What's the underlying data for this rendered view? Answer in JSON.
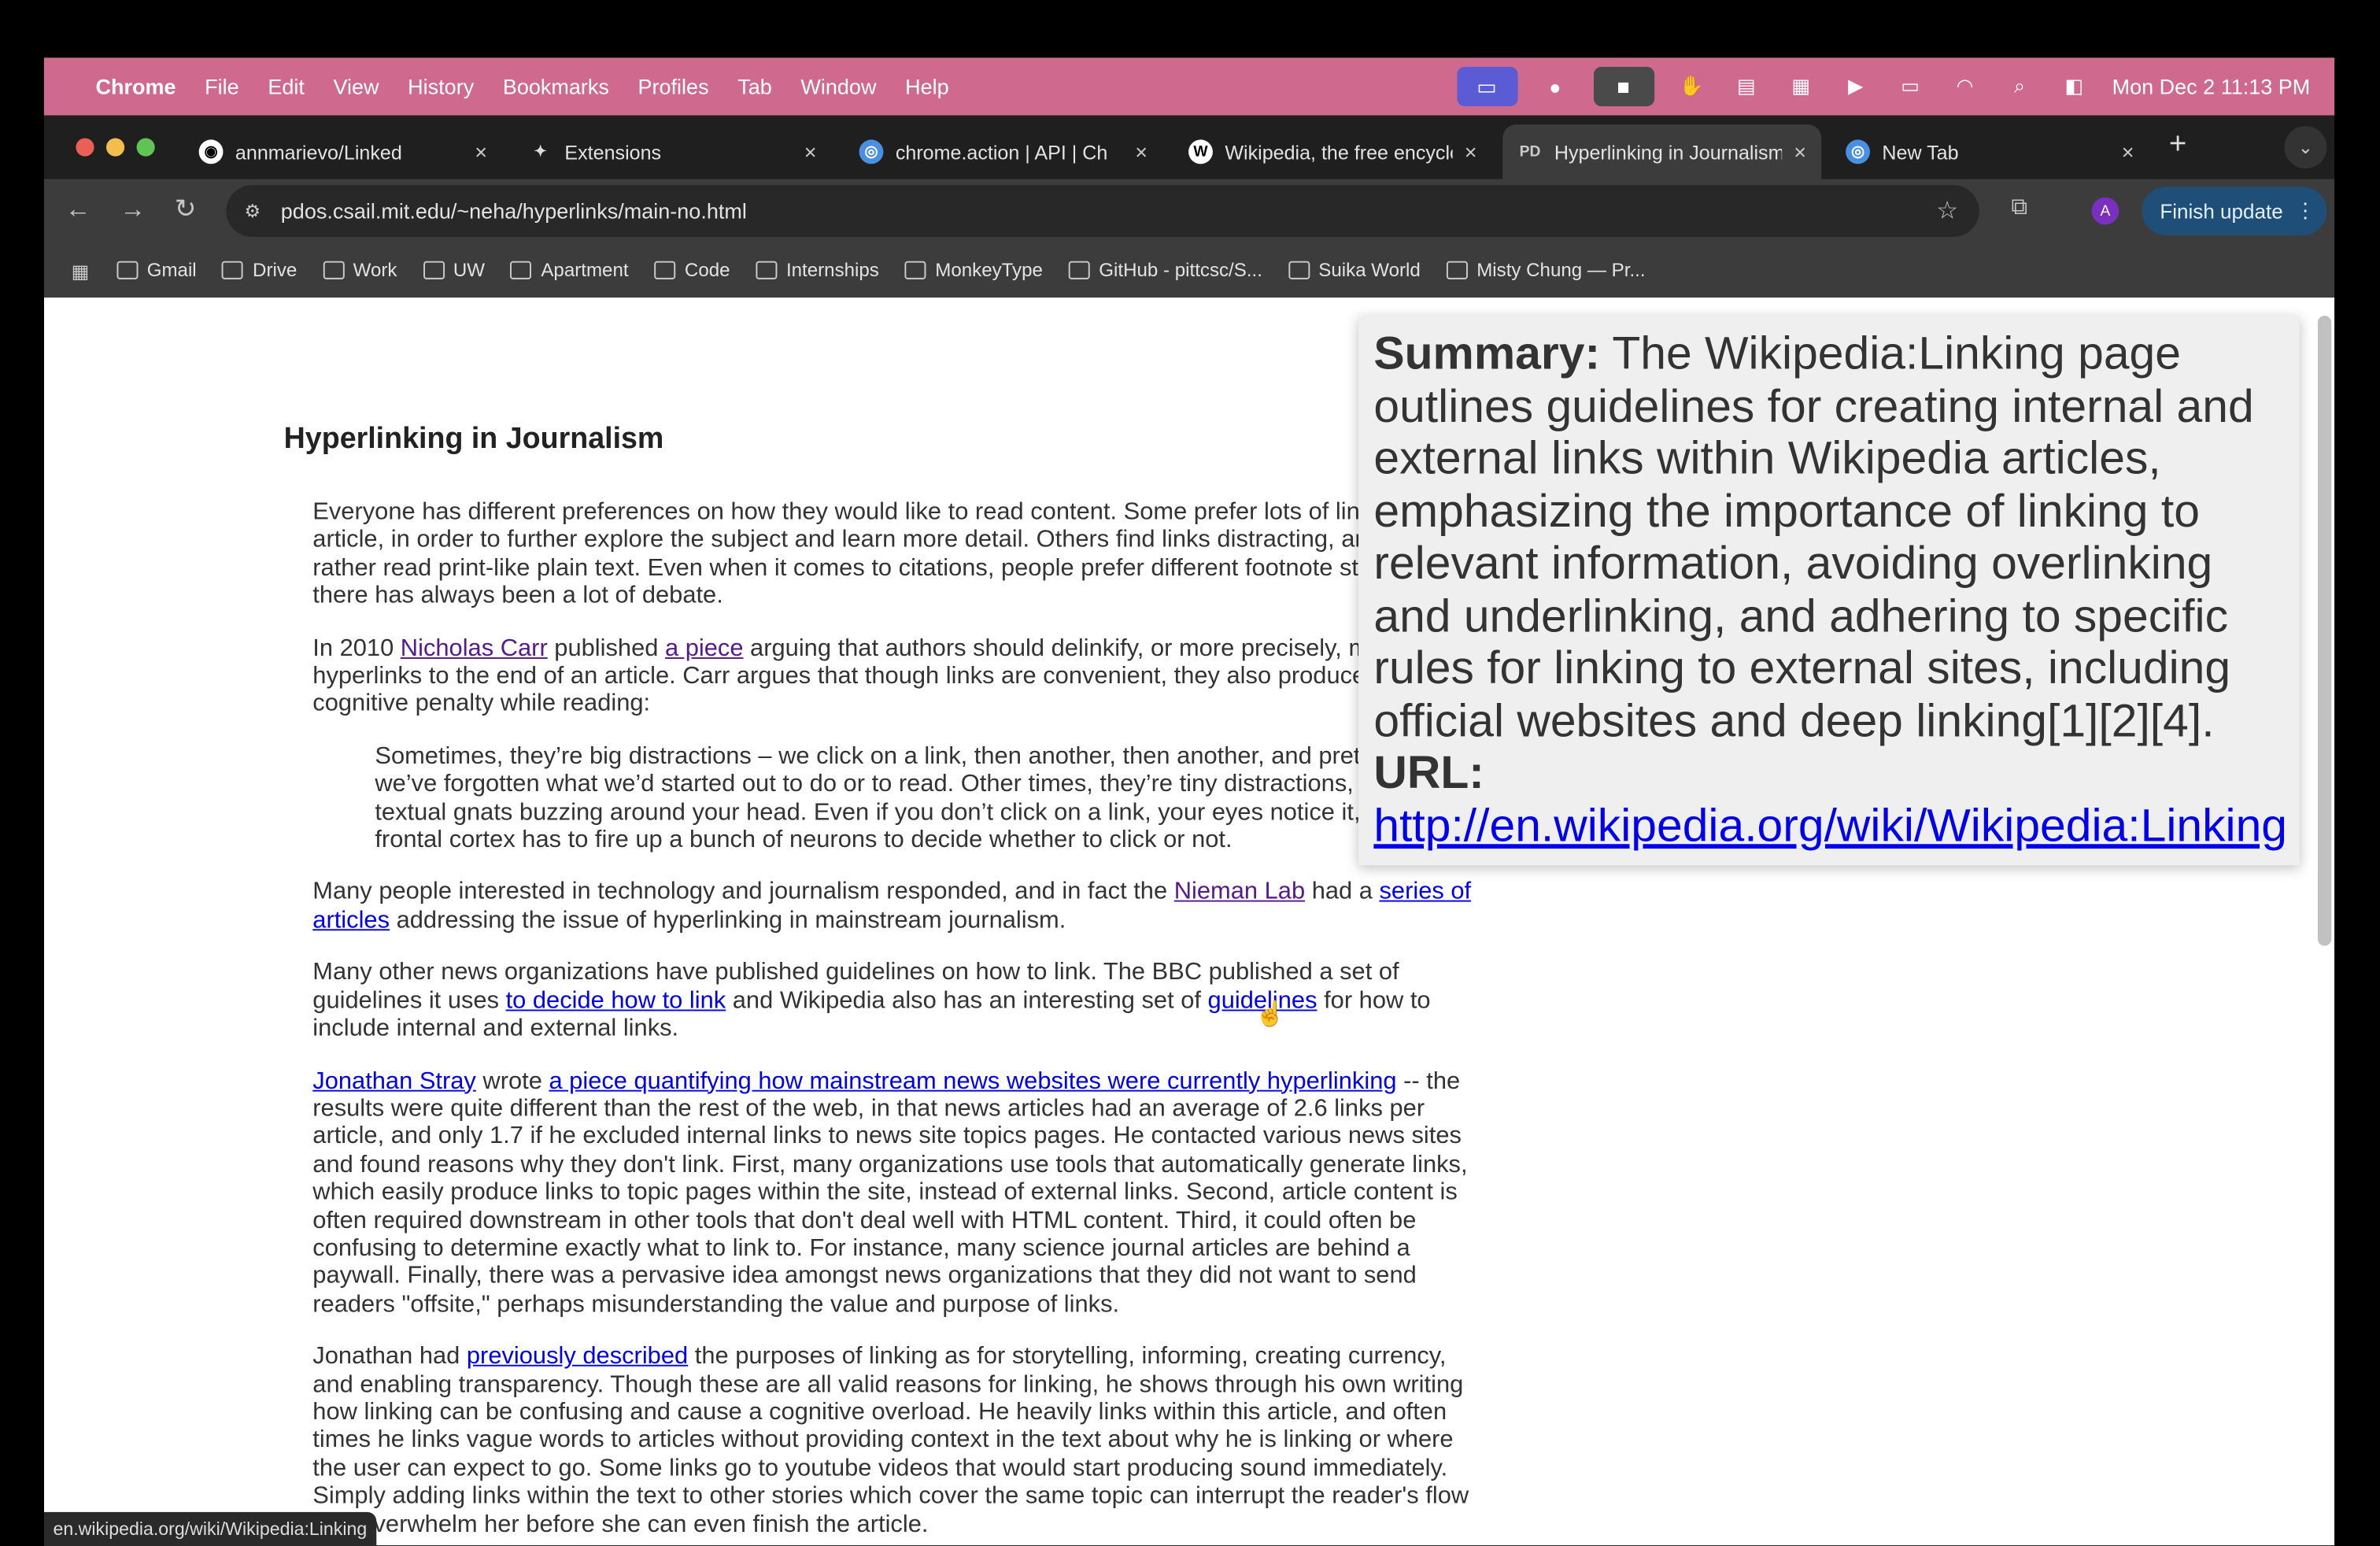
{
  "menubar": {
    "app": "Chrome",
    "items": [
      "File",
      "Edit",
      "View",
      "History",
      "Bookmarks",
      "Profiles",
      "Tab",
      "Window",
      "Help"
    ],
    "clock": "Mon Dec 2  11:13 PM"
  },
  "tabs": [
    {
      "label": "annmarievo/Linked",
      "icon": "github-icon"
    },
    {
      "label": "Extensions",
      "icon": "puzzle-icon"
    },
    {
      "label": "chrome.action | API | Ch",
      "icon": "chrome-icon"
    },
    {
      "label": "Wikipedia, the free encyclopedia",
      "icon": "wikipedia-icon"
    },
    {
      "label": "Hyperlinking in Journalism",
      "icon": "pdos-icon",
      "active": true
    },
    {
      "label": "New Tab",
      "icon": "chrome-icon"
    }
  ],
  "toolbar": {
    "url": "pdos.csail.mit.edu/~neha/hyperlinks/main-no.html",
    "finish_update": "Finish update",
    "avatar": "A"
  },
  "bookmarks": [
    "Gmail",
    "Drive",
    "Work",
    "UW",
    "Apartment",
    "Code",
    "Internships",
    "MonkeyType",
    "GitHub - pittcsc/S...",
    "Suika World",
    "Misty Chung — Pr..."
  ],
  "article": {
    "title": "Hyperlinking in Journalism",
    "blocks": [
      {
        "type": "p",
        "segs": [
          {
            "t": "Everyone has different preferences on how they would like to read content. Some prefer lots of links in an article, in order to further explore the subject and learn more detail. Others find links distracting, and would rather read print-like plain text. Even when it comes to citations, people prefer different footnote styles and there has always been a lot of debate."
          }
        ]
      },
      {
        "type": "p",
        "segs": [
          {
            "t": "In 2010 "
          },
          {
            "t": "Nicholas Carr",
            "link": "visited"
          },
          {
            "t": " published "
          },
          {
            "t": "a piece",
            "link": "visited"
          },
          {
            "t": " arguing that authors should delinkify, or more precisely, move hyperlinks to the end of an article. Carr argues that though links are convenient, they also produce a cognitive penalty while reading:"
          }
        ]
      },
      {
        "type": "q",
        "segs": [
          {
            "t": "Sometimes, they’re big distractions – we click on a link, then another, then another, and pretty soon we’ve forgotten what we’d started out to do or to read. Other times, they’re tiny distractions, little textual gnats buzzing around your head. Even if you don’t click on a link, your eyes notice it, and your frontal cortex has to fire up a bunch of neurons to decide whether to click or not."
          }
        ]
      },
      {
        "type": "p",
        "segs": [
          {
            "t": "Many people interested in technology and journalism responded, and in fact the "
          },
          {
            "t": "Nieman Lab",
            "link": "visited"
          },
          {
            "t": " had a "
          },
          {
            "t": "series of articles",
            "link": "new"
          },
          {
            "t": " addressing the issue of hyperlinking in mainstream journalism."
          }
        ]
      },
      {
        "type": "p",
        "segs": [
          {
            "t": "Many other news organizations have published guidelines on how to link. The BBC published a set of guidelines it uses "
          },
          {
            "t": "to decide how to link",
            "link": "new"
          },
          {
            "t": " and Wikipedia also has an interesting set of "
          },
          {
            "t": "guidelines",
            "link": "new"
          },
          {
            "t": " for how to include internal and external links."
          }
        ]
      },
      {
        "type": "p",
        "segs": [
          {
            "t": "Jonathan Stray",
            "link": "new"
          },
          {
            "t": " wrote "
          },
          {
            "t": "a piece quantifying how mainstream news websites were currently hyperlinking",
            "link": "new"
          },
          {
            "t": " -- the results were quite different than the rest of the web, in that news articles had an average of 2.6 links per article, and only 1.7 if he excluded internal links to news site topics pages. He contacted various news sites and found reasons why they don't link. First, many organizations use tools that automatically generate links, which easily produce links to topic pages within the site, instead of external links. Second, article content is often required downstream in other tools that don't deal well with HTML content. Third, it could often be confusing to determine exactly what to link to. For instance, many science journal articles are behind a paywall. Finally, there was a pervasive idea amongst news organizations that they did not want to send readers \"offsite,\" perhaps misunderstanding the value and purpose of links."
          }
        ]
      },
      {
        "type": "p",
        "segs": [
          {
            "t": "Jonathan had "
          },
          {
            "t": "previously described",
            "link": "new"
          },
          {
            "t": " the purposes of linking as for storytelling, informing, creating currency, and enabling transparency. Though these are all valid reasons for linking, he shows through his own writing how linking can be confusing and cause a cognitive overload. He heavily links within this article, and often times he links vague words to articles without providing context in the text about why he is linking or where the user can expect to go. Some links go to youtube videos that would start producing sound immediately. Simply adding links within the text to other stories which cover the same topic can interrupt the reader's flow and overwhelm her before she can even finish the article."
          }
        ]
      }
    ]
  },
  "popup": {
    "summary_label": "Summary:",
    "summary": " The Wikipedia:Linking page outlines guidelines for creating internal and external links within Wikipedia articles, emphasizing the importance of linking to relevant information, avoiding overlinking and underlinking, and adhering to specific rules for linking to external sites, including official websites and deep linking[1][2][4].",
    "url_label": "URL:",
    "url": "http://en.wikipedia.org/wiki/Wikipedia:Linking"
  },
  "status_bar": "en.wikipedia.org/wiki/Wikipedia:Linking",
  "colors": {
    "menubar": "#cf6a8e",
    "link": "#0000ee",
    "visited": "#551a8b",
    "finish_update": "#1f4e79"
  }
}
